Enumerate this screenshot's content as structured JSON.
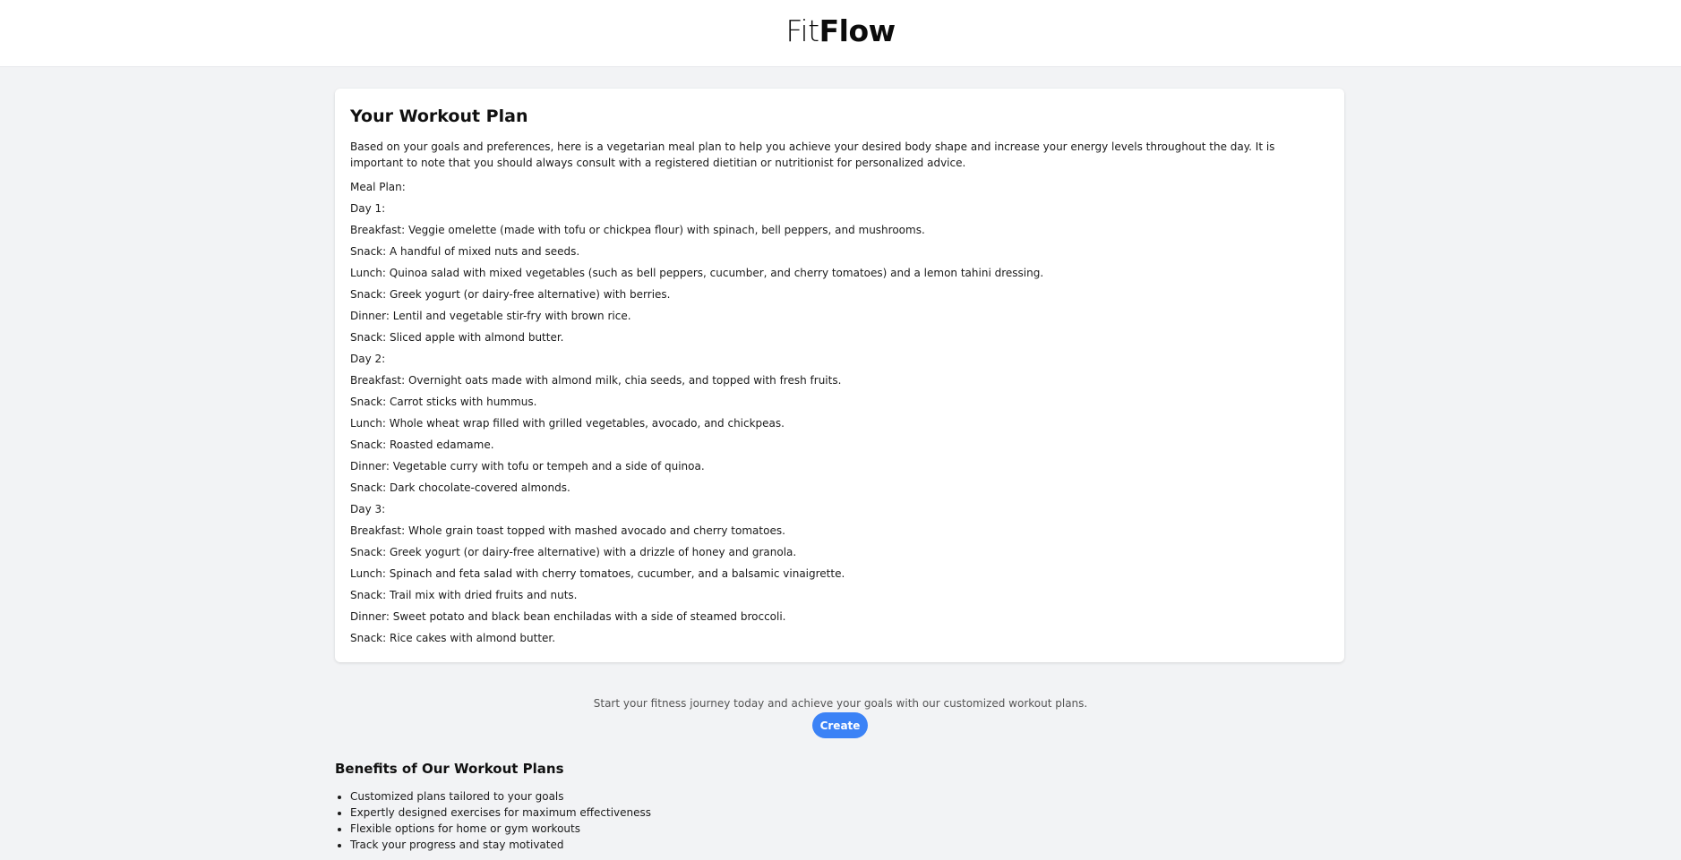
{
  "header": {
    "logo_part1": "Fit",
    "logo_part2": "Flow"
  },
  "plan": {
    "title": "Your Workout Plan",
    "intro": "Based on your goals and preferences, here is a vegetarian meal plan to help you achieve your desired body shape and increase your energy levels throughout the day. It is important to note that you should always consult with a registered dietitian or nutritionist for personalized advice.",
    "lines": [
      "Meal Plan:",
      "Day 1:",
      "Breakfast: Veggie omelette (made with tofu or chickpea flour) with spinach, bell peppers, and mushrooms.",
      "Snack: A handful of mixed nuts and seeds.",
      "Lunch: Quinoa salad with mixed vegetables (such as bell peppers, cucumber, and cherry tomatoes) and a lemon tahini dressing.",
      "Snack: Greek yogurt (or dairy-free alternative) with berries.",
      "Dinner: Lentil and vegetable stir-fry with brown rice.",
      "Snack: Sliced apple with almond butter.",
      "Day 2:",
      "Breakfast: Overnight oats made with almond milk, chia seeds, and topped with fresh fruits.",
      "Snack: Carrot sticks with hummus.",
      "Lunch: Whole wheat wrap filled with grilled vegetables, avocado, and chickpeas.",
      "Snack: Roasted edamame.",
      "Dinner: Vegetable curry with tofu or tempeh and a side of quinoa.",
      "Snack: Dark chocolate-covered almonds.",
      "Day 3:",
      "Breakfast: Whole grain toast topped with mashed avocado and cherry tomatoes.",
      "Snack: Greek yogurt (or dairy-free alternative) with a drizzle of honey and granola.",
      "Lunch: Spinach and feta salad with cherry tomatoes, cucumber, and a balsamic vinaigrette.",
      "Snack: Trail mix with dried fruits and nuts.",
      "Dinner: Sweet potato and black bean enchiladas with a side of steamed broccoli.",
      "Snack: Rice cakes with almond butter."
    ]
  },
  "cta": {
    "text": "Start your fitness journey today and achieve your goals with our customized workout plans.",
    "button_label": "Create"
  },
  "benefits": {
    "title": "Benefits of Our Workout Plans",
    "items": [
      "Customized plans tailored to your goals",
      "Expertly designed exercises for maximum effectiveness",
      "Flexible options for home or gym workouts",
      "Track your progress and stay motivated"
    ]
  },
  "colors": {
    "accent": "#3b82f6",
    "page_background": "#f2f3f5",
    "card_background": "#ffffff"
  }
}
